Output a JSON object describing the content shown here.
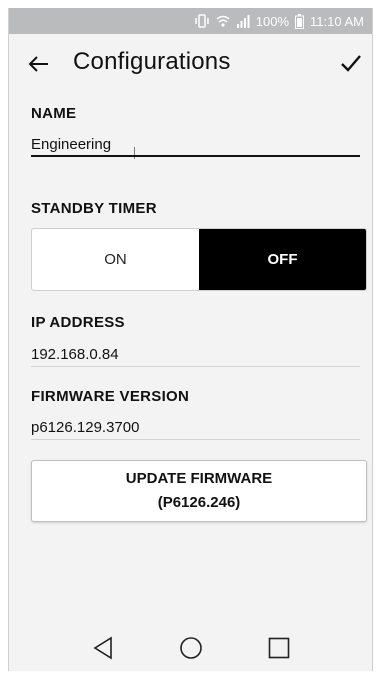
{
  "status_bar": {
    "battery": "100%",
    "time": "11:10 AM",
    "icons": [
      "vibrate-icon",
      "wifi-icon",
      "signal-icon",
      "battery-icon"
    ]
  },
  "app_bar": {
    "title": "Configurations",
    "back_icon": "arrow-left-icon",
    "confirm_icon": "check-icon"
  },
  "name": {
    "label": "NAME",
    "value": "Engineering"
  },
  "standby_timer": {
    "label": "STANDBY TIMER",
    "options": [
      "ON",
      "OFF"
    ],
    "selected": "OFF"
  },
  "ip_address": {
    "label": "IP ADDRESS",
    "value": "192.168.0.84"
  },
  "firmware_version": {
    "label": "FIRMWARE VERSION",
    "value": "p6126.129.3700"
  },
  "update_button": {
    "line1": "UPDATE FIRMWARE",
    "line2": "(P6126.246)"
  },
  "nav_bar": {
    "icons": [
      "back-triangle-icon",
      "home-circle-icon",
      "recents-square-icon"
    ]
  }
}
